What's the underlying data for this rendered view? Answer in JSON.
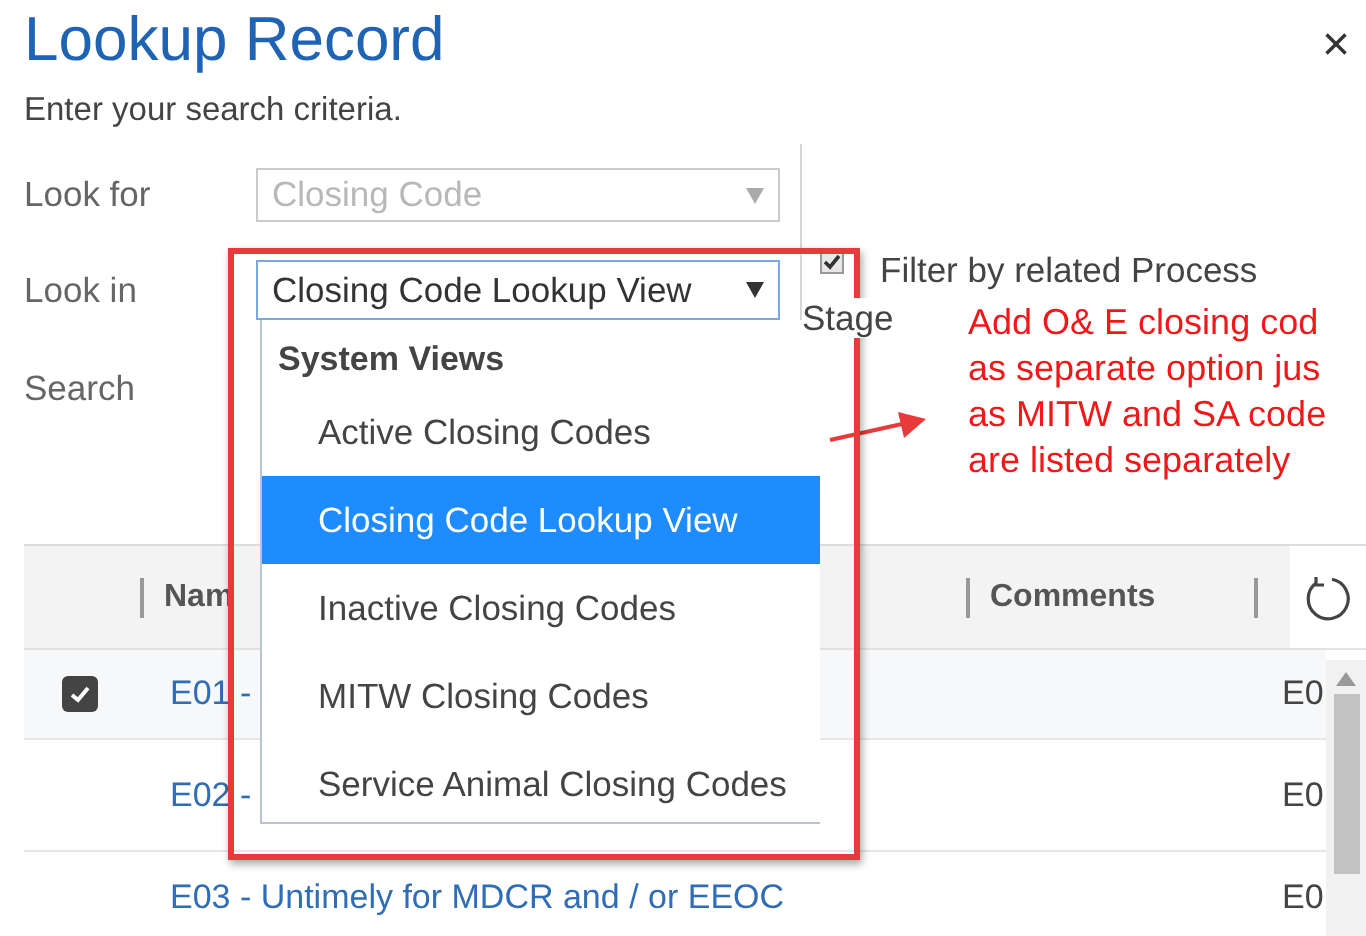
{
  "dialog": {
    "title": "Lookup Record",
    "subtitle": "Enter your search criteria.",
    "close": "×"
  },
  "fields": [
    {
      "label": "Look for",
      "value": "Closing Code",
      "disabled": true,
      "focused": false
    },
    {
      "label": "Look in",
      "value": "Closing Code Lookup View",
      "disabled": false,
      "focused": true
    },
    {
      "label": "Search"
    }
  ],
  "filter": {
    "label_lines": [
      "Filter by related Process",
      "Stage"
    ],
    "checked": true
  },
  "view_menu": {
    "group": "System Views",
    "items": [
      {
        "label": "Active Closing Codes",
        "selected": false
      },
      {
        "label": "Closing Code Lookup View",
        "selected": true
      },
      {
        "label": "Inactive Closing Codes",
        "selected": false
      },
      {
        "label": "MITW Closing Codes",
        "selected": false
      },
      {
        "label": "Service Animal Closing Codes",
        "selected": false
      }
    ]
  },
  "annotation": {
    "text": "Add O& E closing cod\nas separate option jus\nas MITW and SA code\nare listed separately"
  },
  "grid": {
    "columns": [
      "Nam",
      "Comments"
    ],
    "rows": [
      {
        "selected": true,
        "name": "E01 -",
        "code": "E0"
      },
      {
        "selected": false,
        "name": "E02 -",
        "code": "E0"
      },
      {
        "selected": false,
        "name": "E03 - Untimely for MDCR and / or EEOC",
        "code": "E0"
      }
    ]
  }
}
